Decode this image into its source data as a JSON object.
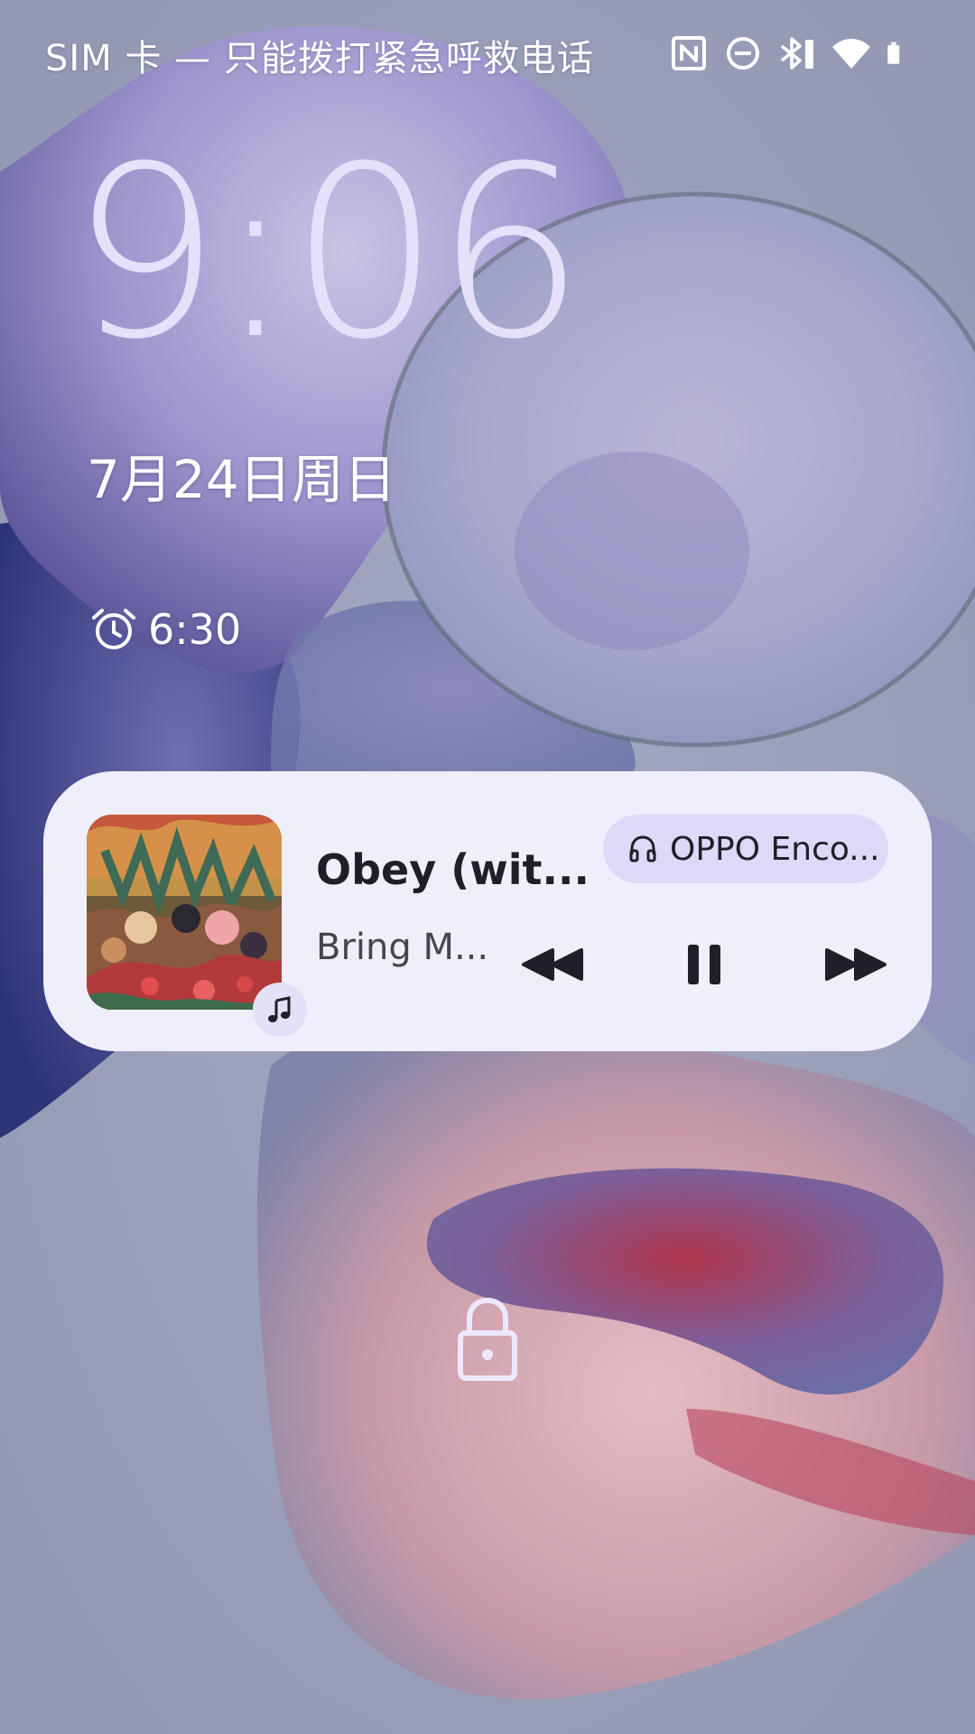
{
  "status_bar": {
    "carrier_text": "SIM 卡 — 只能拨打紧急呼救电话",
    "icons": [
      "nfc-icon",
      "do-not-disturb-icon",
      "bluetooth-battery-icon",
      "wifi-icon",
      "battery-icon"
    ]
  },
  "lockscreen": {
    "time": "9:06",
    "date": "7月24日周日",
    "alarm_time": "6:30"
  },
  "media": {
    "title": "Obey (wit...",
    "artist": "Bring M...",
    "output_device": "OPPO Enco...",
    "state": "playing",
    "controls": [
      "previous",
      "pause",
      "next"
    ]
  },
  "colors": {
    "clock": "#e5e1fb",
    "card_bg": "#efeefb",
    "chip_bg": "#dcdaf8",
    "text_dark": "#1f1f29"
  }
}
